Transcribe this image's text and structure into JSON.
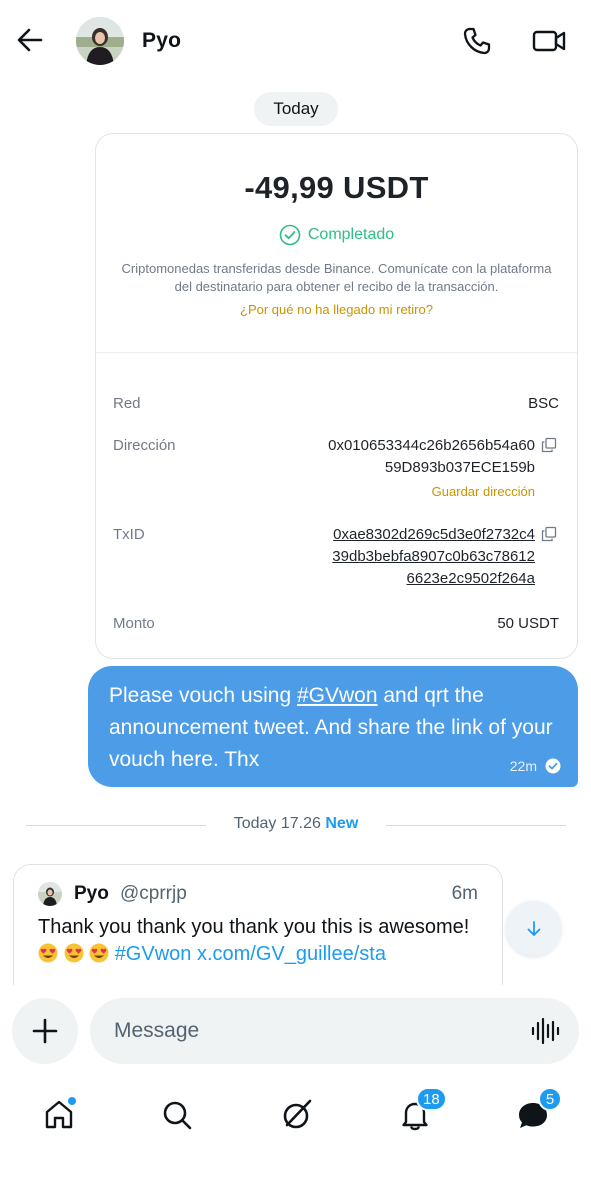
{
  "header": {
    "contact_name": "Pyo"
  },
  "conversation": {
    "day_label": "Today"
  },
  "transaction": {
    "amount": "-49,99 USDT",
    "status": "Completado",
    "description": "Criptomonedas transferidas desde Binance. Comunícate con la plataforma del destinatario para obtener el recibo de la transacción.",
    "help_link": "¿Por qué no ha llegado mi retiro?",
    "network_label": "Red",
    "network_value": "BSC",
    "address_label": "Dirección",
    "address_line1": "0x010653344c26b2656b54a60",
    "address_line2": "59D893b037ECE159b",
    "save_address": "Guardar dirección",
    "txid_label": "TxID",
    "txid_line1": "0xae8302d269c5d3e0f2732c4",
    "txid_line2": "39db3bebfa8907c0b63c78612",
    "txid_line3": "6623e2c9502f264a",
    "amount_label": "Monto",
    "amount_value": "50 USDT"
  },
  "outgoing_message": {
    "text_before": "Please vouch using ",
    "hashtag": "#GVwon",
    "text_after": " and qrt the announcement tweet. And share the link of your vouch here. Thx",
    "time": "22m"
  },
  "separator": {
    "time_text": "Today 17.26",
    "new_label": "New"
  },
  "incoming_post": {
    "name": "Pyo",
    "handle": "@cprrjp",
    "time": "6m",
    "text_start": "Thank you thank  you thank you this is awesome! ",
    "hashtag": "#GVwon",
    "link": "x.com/GV_guillee/sta"
  },
  "composer": {
    "placeholder": "Message"
  },
  "bottom_nav": {
    "notifications_count": "18",
    "messages_count": "5"
  },
  "colors": {
    "accent": "#1d9bf0",
    "bubble": "#4d9ce8",
    "success": "#2ebd85",
    "binance_gold": "#c99400"
  }
}
